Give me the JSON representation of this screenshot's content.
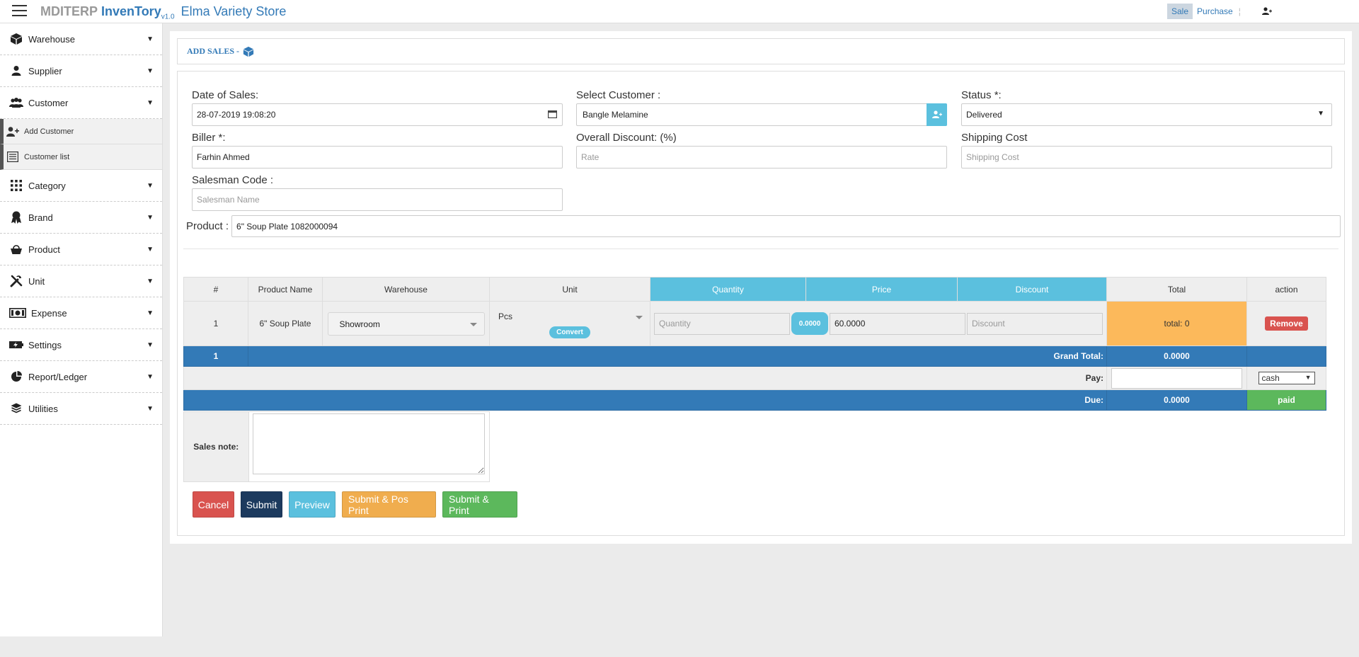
{
  "header": {
    "brand_prefix": "MDITERP",
    "brand_name": "InvenTory",
    "brand_version": "v1.0",
    "store_name": "Elma Variety Store",
    "nav": [
      {
        "label": "Sale",
        "active": true
      },
      {
        "label": "Purchase",
        "active": false
      }
    ],
    "separator": "¦"
  },
  "sidebar": {
    "items": [
      {
        "label": "Warehouse",
        "icon": "cube-icon"
      },
      {
        "label": "Supplier",
        "icon": "user-icon"
      },
      {
        "label": "Customer",
        "icon": "users-icon"
      },
      {
        "label": "Category",
        "icon": "grid-icon"
      },
      {
        "label": "Brand",
        "icon": "award-icon"
      },
      {
        "label": "Product",
        "icon": "basket-icon"
      },
      {
        "label": "Unit",
        "icon": "tools-icon"
      },
      {
        "label": "Expense",
        "icon": "money-icon"
      },
      {
        "label": "Settings",
        "icon": "power-icon"
      },
      {
        "label": "Report/Ledger",
        "icon": "pie-chart-icon"
      },
      {
        "label": "Utilities",
        "icon": "layers-icon"
      }
    ],
    "customer_sub": [
      {
        "label": "Add Customer",
        "icon": "user-plus-icon"
      },
      {
        "label": "Customer list",
        "icon": "list-icon"
      }
    ],
    "caret": "▼"
  },
  "page": {
    "title": "ADD SALES -",
    "form": {
      "date_label": "Date of Sales:",
      "date_value": "28-07-2019 19:08:20",
      "customer_label": "Select Customer :",
      "customer_value": "Bangle Melamine",
      "status_label": "Status *:",
      "status_value": "Delivered",
      "biller_label": "Biller *:",
      "biller_value": "Farhin Ahmed",
      "discount_label": "Overall Discount: (%)",
      "discount_placeholder": "Rate",
      "shipping_label": "Shipping Cost",
      "shipping_placeholder": "Shipping Cost",
      "salesman_label": "Salesman Code :",
      "salesman_placeholder": "Salesman Name",
      "product_label": "Product :",
      "product_value": "6\" Soup Plate 1082000094"
    },
    "table": {
      "headers": [
        "#",
        "Product Name",
        "Warehouse",
        "Unit",
        "Quantity",
        "Price",
        "Discount",
        "Total",
        "action"
      ],
      "row": {
        "index": "1",
        "product_name": "6\" Soup Plate",
        "warehouse": "Showroom",
        "unit": "Pcs",
        "convert_label": "Convert",
        "quantity_placeholder": "Quantity",
        "rate_badge": "0.0000",
        "price_value": "60.0000",
        "discount_placeholder": "Discount",
        "total": "total: 0",
        "remove_label": "Remove"
      },
      "grand": {
        "count": "1",
        "label": "Grand Total:",
        "value": "0.0000"
      },
      "pay": {
        "label": "Pay:",
        "method": "cash"
      },
      "due": {
        "label": "Due:",
        "value": "0.0000",
        "status": "paid"
      }
    },
    "note_label": "Sales note:",
    "buttons": {
      "cancel": "Cancel",
      "submit": "Submit",
      "preview": "Preview",
      "pos_print": "Submit & Pos Print",
      "print": "Submit & Print"
    }
  }
}
